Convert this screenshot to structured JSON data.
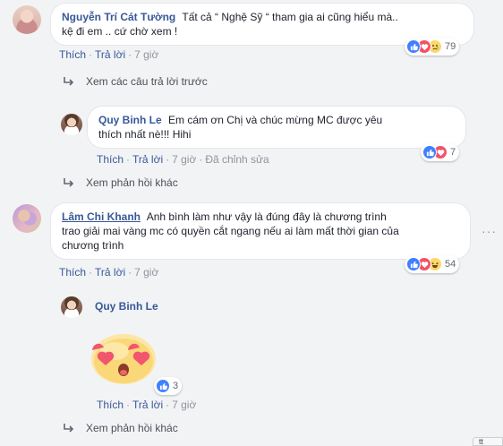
{
  "comments": [
    {
      "author": "Nguyễn Trí Cát Tường",
      "line1": "Tất cả “ Nghệ Sỹ “ tham gia ai cũng hiểu mà..",
      "line2": "kệ đi em .. cứ chờ xem !",
      "actions": {
        "like": "Thích",
        "reply": "Trả lời",
        "time": "7 giờ"
      },
      "reactions": {
        "types": [
          "like-icon",
          "love-icon",
          "sad-icon"
        ],
        "count": "79"
      }
    },
    {
      "author": "Lâm Chi Khanh",
      "line1": "Anh bình làm như vậy là đúng đây là chương trình",
      "line2": "trao giải mai vàng mc có quyền cắt ngang nếu ai làm mất thời gian của",
      "line3": "chương trình",
      "actions": {
        "like": "Thích",
        "reply": "Trả lời",
        "time": "7 giờ"
      },
      "reactions": {
        "types": [
          "like-icon",
          "love-icon",
          "haha-icon"
        ],
        "count": "54"
      }
    }
  ],
  "replies": [
    {
      "author": "Quy Binh Le",
      "line1": "Em cám ơn Chị và chúc mừng MC được yêu",
      "line2": "thích nhất nè!!! Hihi",
      "actions": {
        "like": "Thích",
        "reply": "Trả lời",
        "time": "7 giờ",
        "edited": "Đã chỉnh sửa"
      },
      "reactions": {
        "types": [
          "like-icon",
          "love-icon"
        ],
        "count": "7"
      }
    },
    {
      "author": "Quy Binh Le",
      "sticker": "heart-eyes-sticker",
      "actions": {
        "like": "Thích",
        "reply": "Trả lời",
        "time": "7 giờ"
      },
      "reactions": {
        "types": [
          "like-icon"
        ],
        "count": "3"
      }
    }
  ],
  "links": {
    "previous_replies": "Xem các câu trả lời trước",
    "more_replies_1": "Xem phản hồi khác",
    "more_replies_2": "Xem phản hồi khác"
  },
  "more_options": "···",
  "corner_badge": "tt",
  "colors": {
    "link": "#385898",
    "like": "#4080ff",
    "love": "#f25268",
    "emoji": "#fcd86a"
  }
}
